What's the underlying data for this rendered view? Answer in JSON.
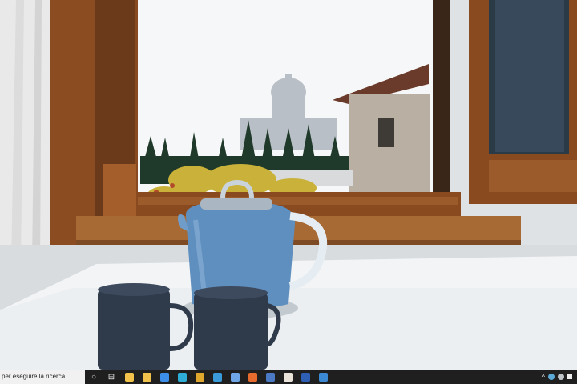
{
  "colors": {
    "taskbar": "#1f1f1f",
    "search_bg": "#f1f1f1",
    "frame": "#8a4a1f",
    "sky": "#f6f7f8",
    "table": "#f2f4f6",
    "kettle": "#5f8fbf",
    "mug": "#2f3a4b"
  },
  "wallpaper": {
    "scene": "kettle-and-mugs-by-window"
  },
  "taskbar": {
    "search_placeholder": "per eseguire la ricerca",
    "start_glyph": "○",
    "taskview_glyph": "⊟",
    "apps": [
      {
        "name": "store-icon",
        "color": "#f2c24a"
      },
      {
        "name": "file-explorer-icon",
        "color": "#f0c14b"
      },
      {
        "name": "dropbox-icon",
        "color": "#3d8ee8"
      },
      {
        "name": "edge-icon",
        "color": "#2eaed6"
      },
      {
        "name": "chrome-icon",
        "color": "#e0a72d"
      },
      {
        "name": "app-blue-icon",
        "color": "#3a9bd8"
      },
      {
        "name": "app-cloud-icon",
        "color": "#6fa7e6"
      },
      {
        "name": "firefox-icon",
        "color": "#e76b2c"
      },
      {
        "name": "app-folder-icon",
        "color": "#4b79c4"
      },
      {
        "name": "app-gallery-icon",
        "color": "#e9e3da"
      },
      {
        "name": "word-icon",
        "color": "#2f5fb3"
      },
      {
        "name": "app-media-icon",
        "color": "#3b88d3"
      }
    ],
    "tray": {
      "chevron": "^",
      "icons": [
        {
          "name": "tray-weather-icon",
          "color": "#5aa9d6"
        },
        {
          "name": "tray-network-icon",
          "color": "#bfc4c8"
        }
      ]
    }
  }
}
